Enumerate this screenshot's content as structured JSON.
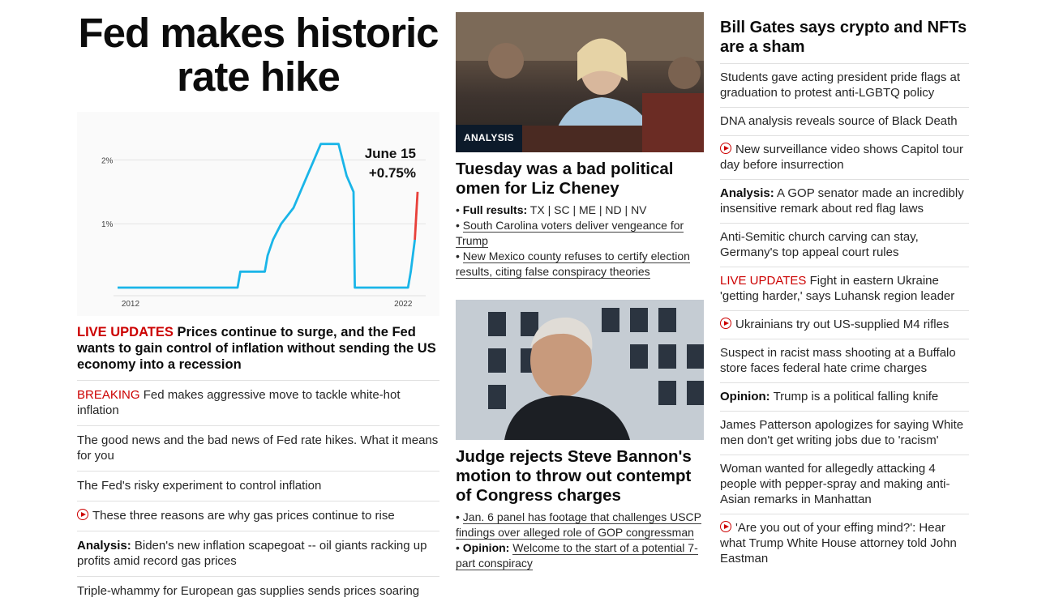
{
  "col1": {
    "headline": "Fed makes historic rate hike",
    "lead_live": "LIVE UPDATES",
    "lead_text": "Prices continue to surge, and the Fed wants to gain control of inflation without sending the US economy into a recession",
    "items": [
      {
        "kind": "breaking",
        "prefix": "BREAKING",
        "text": "Fed makes aggressive move to tackle white-hot inflation"
      },
      {
        "kind": "plain",
        "text": "The good news and the bad news of Fed rate hikes. What it means for you"
      },
      {
        "kind": "plain",
        "text": "The Fed's risky experiment to control inflation"
      },
      {
        "kind": "video",
        "text": "These three reasons are why gas prices continue to rise"
      },
      {
        "kind": "analysis",
        "prefix": "Analysis:",
        "text": "Biden's new inflation scapegoat -- oil giants racking up profits amid record gas prices"
      },
      {
        "kind": "plain",
        "text": "Triple-whammy for European gas supplies sends prices soaring"
      }
    ]
  },
  "chart_data": {
    "type": "line",
    "title": "",
    "x_ticks": [
      "2012",
      "2022"
    ],
    "y_ticks": [
      "1%",
      "2%"
    ],
    "ylim": [
      0,
      2.5
    ],
    "xlim": [
      2011.5,
      2022.5
    ],
    "annotation_date": "June 15",
    "annotation_change": "+0.75%",
    "series": [
      {
        "color": "#1ab5e8",
        "points": [
          [
            2011.5,
            0.0
          ],
          [
            2015.9,
            0.0
          ],
          [
            2016.0,
            0.25
          ],
          [
            2016.9,
            0.25
          ],
          [
            2017.0,
            0.5
          ],
          [
            2017.2,
            0.75
          ],
          [
            2017.5,
            1.0
          ],
          [
            2017.95,
            1.25
          ],
          [
            2018.2,
            1.5
          ],
          [
            2018.45,
            1.75
          ],
          [
            2018.7,
            2.0
          ],
          [
            2018.95,
            2.25
          ],
          [
            2019.6,
            2.25
          ],
          [
            2019.75,
            2.0
          ],
          [
            2019.9,
            1.75
          ],
          [
            2020.15,
            1.5
          ],
          [
            2020.2,
            0.0
          ],
          [
            2022.15,
            0.0
          ],
          [
            2022.25,
            0.25
          ],
          [
            2022.4,
            0.75
          ]
        ]
      },
      {
        "color": "#e8403a",
        "points": [
          [
            2022.4,
            0.75
          ],
          [
            2022.5,
            1.5
          ]
        ]
      }
    ]
  },
  "col2": {
    "story1": {
      "badge": "ANALYSIS",
      "headline": "Tuesday was a bad political omen for Liz Cheney",
      "sub1_label": "Full results:",
      "sub1_links": [
        "TX",
        "SC",
        "ME",
        "ND",
        "NV"
      ],
      "sub2": "South Carolina voters deliver vengeance for Trump",
      "sub3": "New Mexico county refuses to certify election results, citing false conspiracy theories"
    },
    "story2": {
      "headline": "Judge rejects Steve Bannon's motion to throw out contempt of Congress charges",
      "sub1": "Jan. 6 panel has footage that challenges USCP findings over alleged role of GOP congressman",
      "sub2_label": "Opinion:",
      "sub2": "Welcome to the start of a potential 7-part conspiracy"
    }
  },
  "col3": {
    "lead": "Bill Gates says crypto and NFTs are a sham",
    "items": [
      {
        "kind": "plain",
        "text": "Students gave acting president pride flags at graduation to protest anti-LGBTQ policy"
      },
      {
        "kind": "plain",
        "text": "DNA analysis reveals source of Black Death"
      },
      {
        "kind": "video",
        "text": "New surveillance video shows Capitol tour day before insurrection"
      },
      {
        "kind": "analysis",
        "prefix": "Analysis:",
        "text": "A GOP senator made an incredibly insensitive remark about red flag laws"
      },
      {
        "kind": "plain",
        "text": "Anti-Semitic church carving can stay, Germany's top appeal court rules"
      },
      {
        "kind": "live",
        "prefix": "LIVE UPDATES",
        "text": "Fight in eastern Ukraine 'getting harder,' says Luhansk region leader"
      },
      {
        "kind": "video",
        "text": "Ukrainians try out US-supplied M4 rifles"
      },
      {
        "kind": "plain",
        "text": "Suspect in racist mass shooting at a Buffalo store faces federal hate crime charges"
      },
      {
        "kind": "analysis",
        "prefix": "Opinion:",
        "text": "Trump is a political falling knife"
      },
      {
        "kind": "plain",
        "text": "James Patterson apologizes for saying White men don't get writing jobs due to 'racism'"
      },
      {
        "kind": "plain",
        "text": "Woman wanted for allegedly attacking 4 people with pepper-spray and making anti-Asian remarks in Manhattan"
      },
      {
        "kind": "video",
        "text": "'Are you out of your effing mind?': Hear what Trump White House attorney told John Eastman"
      }
    ]
  },
  "colors": {
    "live_red": "#cc0000",
    "chart_line": "#1ab5e8",
    "chart_hike": "#e8403a",
    "badge_bg": "#0c1a2a"
  }
}
